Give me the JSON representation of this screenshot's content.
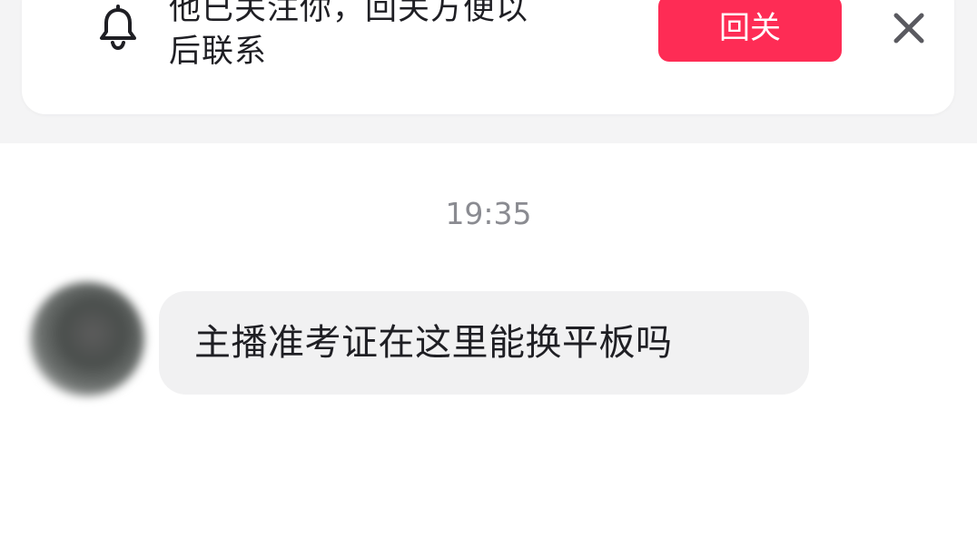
{
  "banner": {
    "icon": "bell-icon",
    "line1": "他已关注你，回关方便以",
    "line2": "后联系",
    "follow_back_label": "回关",
    "close_icon": "close-icon",
    "accent_color": "#fe2c55"
  },
  "chat": {
    "timestamp": "19:35",
    "messages": [
      {
        "sender": "other",
        "text": "主播准考证在这里能换平板吗"
      }
    ]
  }
}
